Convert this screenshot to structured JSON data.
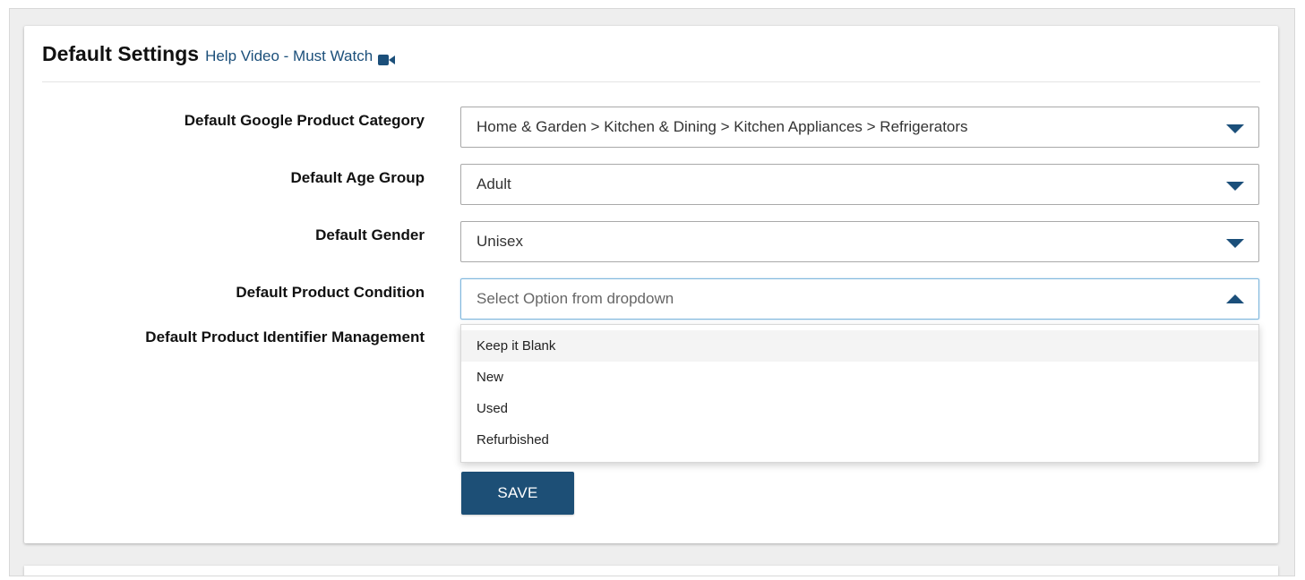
{
  "header": {
    "title": "Default Settings",
    "help_link": "Help Video - Must Watch",
    "help_icon": "video-camera-icon"
  },
  "fields": [
    {
      "label": "Default Google Product Category",
      "value": "Home & Garden > Kitchen & Dining > Kitchen Appliances > Refrigerators"
    },
    {
      "label": "Default Age Group",
      "value": "Adult"
    },
    {
      "label": "Default Gender",
      "value": "Unisex"
    },
    {
      "label": "Default Product Condition",
      "placeholder": "Select Option from dropdown"
    },
    {
      "label": "Default Product Identifier Management"
    }
  ],
  "condition_dropdown": {
    "options": [
      "Keep it Blank",
      "New",
      "Used",
      "Refurbished"
    ],
    "highlighted": "Keep it Blank"
  },
  "save_label": "SAVE",
  "colors": {
    "accent": "#1b4f7a",
    "button_bg": "#1d4f76",
    "focus_border": "#7fb7dd"
  }
}
